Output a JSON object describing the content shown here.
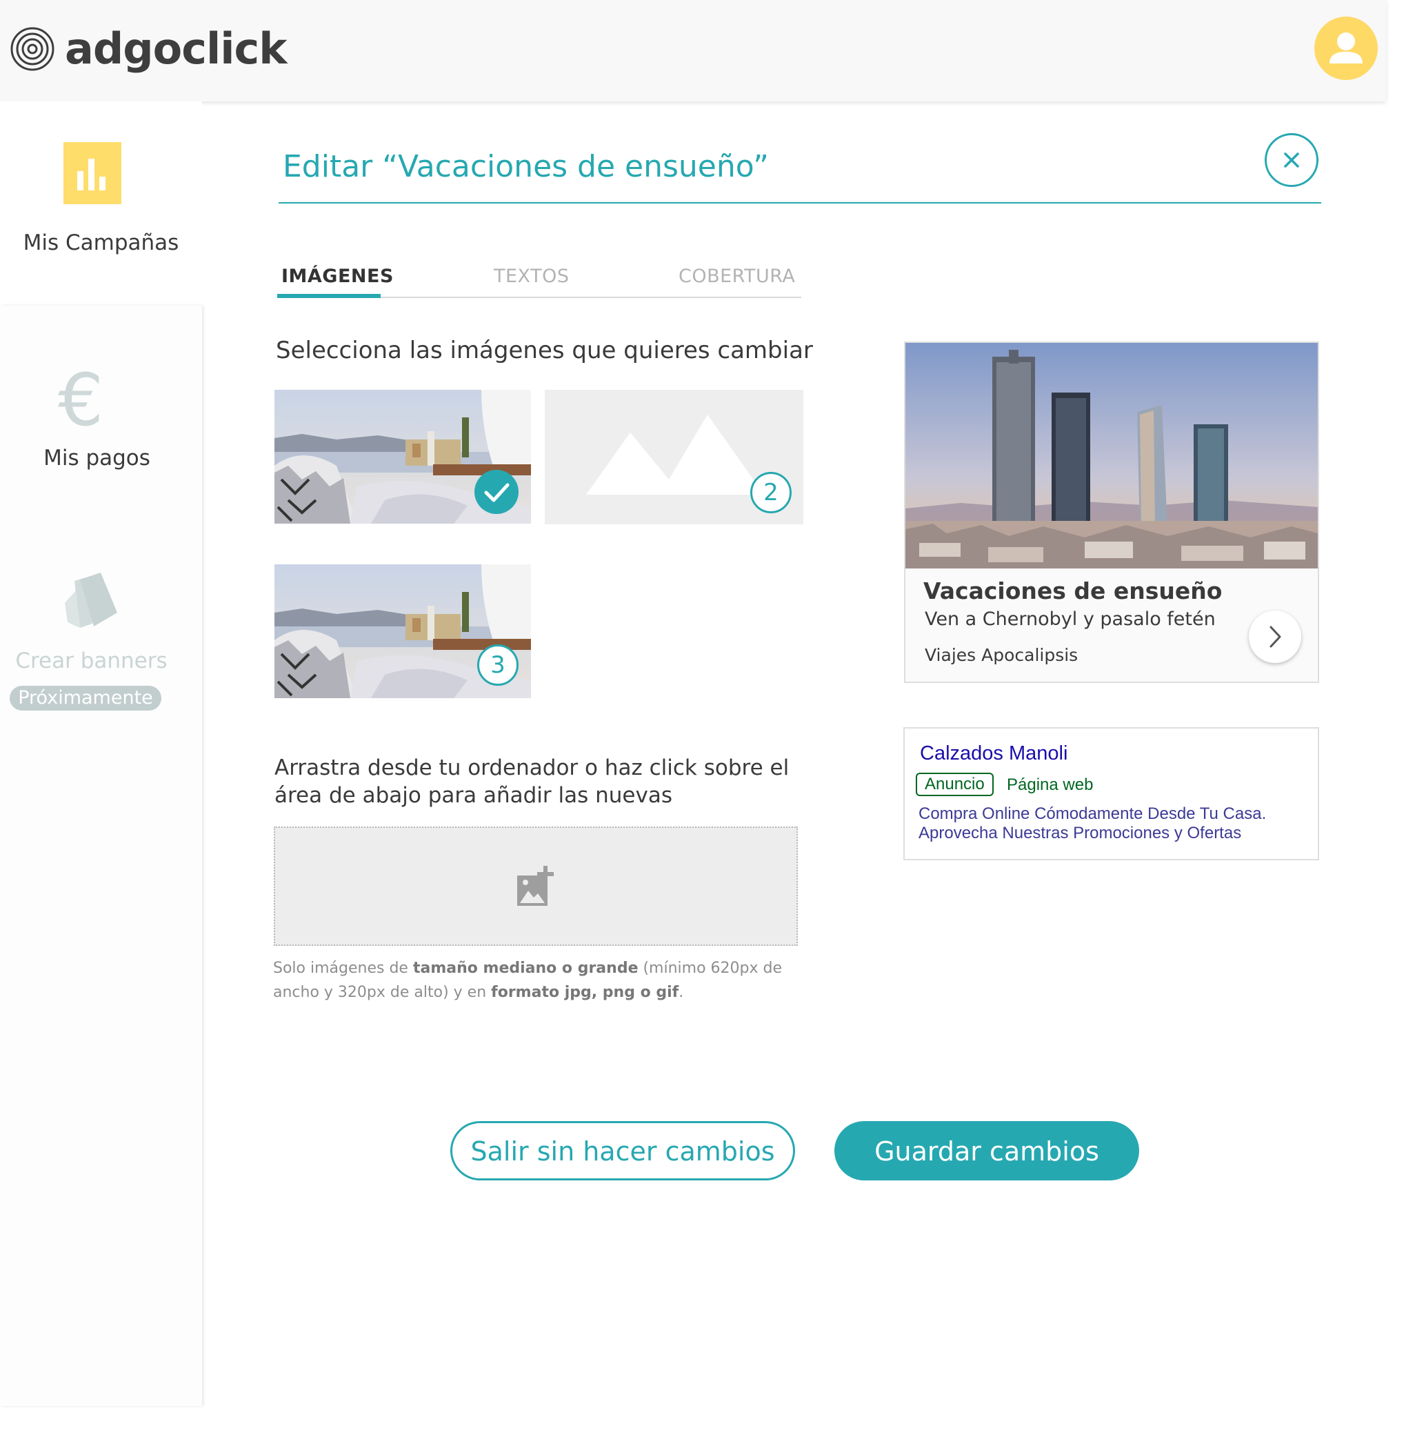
{
  "brand": {
    "name": "adgoclick",
    "logo_icon": "concentric-circles-icon",
    "avatar_icon": "user-icon",
    "accent_color": "#26a8b1",
    "highlight_color": "#ffd966"
  },
  "sidebar": {
    "items": [
      {
        "label": "Mis Campañas",
        "icon": "bar-chart-icon"
      },
      {
        "label": "Mis pagos",
        "icon": "euro-icon",
        "glyph": "€"
      },
      {
        "label": "Crear banners",
        "icon": "color-swatch-icon",
        "badge": "Próximamente"
      }
    ]
  },
  "editor": {
    "title": "Editar “Vacaciones de ensueño”",
    "close_icon": "close-icon",
    "tabs": [
      {
        "label": "IMÁGENES",
        "active": true
      },
      {
        "label": "TEXTOS",
        "active": false
      },
      {
        "label": "COBERTURA",
        "active": false
      }
    ],
    "section_heading": "Selecciona las imágenes que quieres cambiar",
    "thumbnails": [
      {
        "badge": "✓",
        "selected": true
      },
      {
        "badge": "2",
        "placeholder": true
      },
      {
        "badge": "3"
      }
    ],
    "drag_text": "Arrastra desde tu ordenador o haz click sobre el área de abajo para añadir las nuevas",
    "dropzone_icon": "add-photo-icon",
    "helper": {
      "t1": "Solo imágenes de ",
      "b1": "tamaño mediano o grande",
      "t2": " (mínimo 620px de ancho y 320px de alto) y en ",
      "b2": "formato jpg, png o gif",
      "t3": "."
    }
  },
  "preview": {
    "display_ad": {
      "title": "Vacaciones de ensueño",
      "description": "Ven a Chernobyl y pasalo fetén",
      "advertiser": "Viajes Apocalipsis",
      "arrow_icon": "chevron-right-icon"
    },
    "search_ad": {
      "title": "Calzados Manoli",
      "badge": "Anuncio",
      "url": "Página web",
      "line1": "Compra Online Cómodamente Desde Tu Casa.",
      "line2": "Aprovecha Nuestras Promociones y Ofertas"
    }
  },
  "actions": {
    "exit_label": "Salir sin hacer cambios",
    "save_label": "Guardar cambios"
  }
}
